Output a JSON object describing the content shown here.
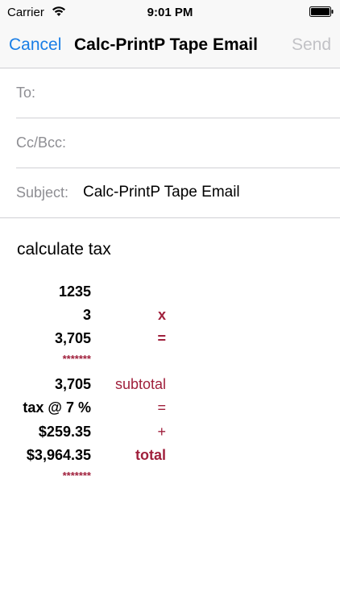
{
  "status_bar": {
    "carrier": "Carrier",
    "time": "9:01 PM",
    "icons": [
      "wifi-icon",
      "battery-icon"
    ]
  },
  "nav": {
    "cancel_label": "Cancel",
    "title": "Calc-PrintP Tape Email",
    "send_label": "Send",
    "accent_color": "#1a7ee6",
    "disabled_color": "#c2c2c6"
  },
  "fields": {
    "to_label": "To:",
    "to_value": "",
    "ccbcc_label": "Cc/Bcc:",
    "ccbcc_value": "",
    "subject_label": "Subject:",
    "subject_value": "Calc-PrintP Tape Email"
  },
  "body": {
    "intro": "calculate tax",
    "op_color": "#a0203c",
    "tape": [
      {
        "num": "1235",
        "op": ""
      },
      {
        "num": "3",
        "op": "x"
      },
      {
        "num": "3,705",
        "op": "="
      },
      {
        "stars": "*******"
      },
      {
        "num": "3,705",
        "op": "subtotal"
      },
      {
        "num": "tax @ 7 %",
        "op": "="
      },
      {
        "num": "$259.35",
        "op": "+"
      },
      {
        "num": "$3,964.35",
        "op": "total"
      },
      {
        "stars": "*******"
      }
    ]
  }
}
